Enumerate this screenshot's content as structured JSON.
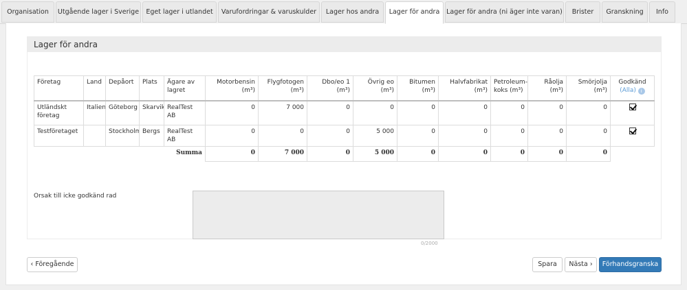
{
  "tabs": [
    {
      "label": "Organisation"
    },
    {
      "label": "Utgående lager i Sverige"
    },
    {
      "label": "Eget lager i utlandet"
    },
    {
      "label": "Varufordringar & varuskulder"
    },
    {
      "label": "Lager hos andra"
    },
    {
      "label": "Lager för andra"
    },
    {
      "label": "Lager för andra (ni äger inte varan)"
    },
    {
      "label": "Brister"
    },
    {
      "label": "Granskning"
    },
    {
      "label": "Info"
    }
  ],
  "active_tab": "Lager för andra",
  "section": {
    "title": "Lager för andra"
  },
  "table": {
    "headers": {
      "foretag": "Företag",
      "land": "Land",
      "depaort": "Depåort",
      "plats": "Plats",
      "agare_1": "Ägare av",
      "agare_2": "lagret",
      "motorbensin": "Motorbensin",
      "flygfotogen": "Flygfotogen",
      "dbo": "Dbo/eo 1",
      "ovrig": "Övrig eo",
      "bitumen": "Bitumen",
      "halvfabrikat": "Halvfabrikat",
      "petroleum_1": "Petroleum-",
      "petroleum_2": "koks (m³)",
      "raolja": "Råolja",
      "smorjolja": "Smörjolja",
      "unit": "(m³)",
      "godkand": "Godkänd",
      "alla": "(Alla)",
      "info_icon": "i"
    },
    "rows": [
      {
        "foretag": "Utländskt företag",
        "land": "Italien",
        "depaort": "Göteborg",
        "plats": "Skarvik",
        "agare": "RealTest AB",
        "values": [
          "0",
          "7 000",
          "0",
          "0",
          "0",
          "0",
          "0",
          "0",
          "0"
        ],
        "godkand": true
      },
      {
        "foretag": "Testföretaget",
        "land": "",
        "depaort": "Stockholm",
        "plats": "Bergs",
        "agare": "RealTest AB",
        "values": [
          "0",
          "0",
          "0",
          "5 000",
          "0",
          "0",
          "0",
          "0",
          "0"
        ],
        "godkand": true
      }
    ],
    "summa_label": "Summa",
    "sums": [
      "0",
      "7 000",
      "0",
      "5 000",
      "0",
      "0",
      "0",
      "0",
      "0"
    ]
  },
  "reason": {
    "label": "Orsak till icke godkänd rad",
    "value": "",
    "counter": "0/2000"
  },
  "buttons": {
    "prev": "‹ Föregående",
    "save": "Spara",
    "next": "Nästa ›",
    "preview": "Förhandsgranska"
  },
  "colors": {
    "primary_button": "#337ab7",
    "info_icon": "#a9c8e8",
    "section_header_bg": "#ececec"
  }
}
